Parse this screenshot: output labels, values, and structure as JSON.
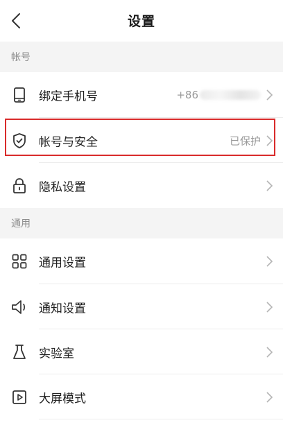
{
  "header": {
    "title": "设置"
  },
  "sections": [
    {
      "title": "帐号"
    },
    {
      "title": "通用"
    }
  ],
  "account": {
    "phone": {
      "label": "绑定手机号",
      "value": "+86"
    },
    "security": {
      "label": "帐号与安全",
      "value": "已保护"
    },
    "privacy": {
      "label": "隐私设置"
    }
  },
  "general": {
    "settings": {
      "label": "通用设置"
    },
    "notifications": {
      "label": "通知设置"
    },
    "lab": {
      "label": "实验室"
    },
    "bigscreen": {
      "label": "大屏模式"
    }
  },
  "colors": {
    "highlight": "#d92b2b",
    "section_bg": "#f4f4f4",
    "muted_text": "#9a9a9a"
  }
}
